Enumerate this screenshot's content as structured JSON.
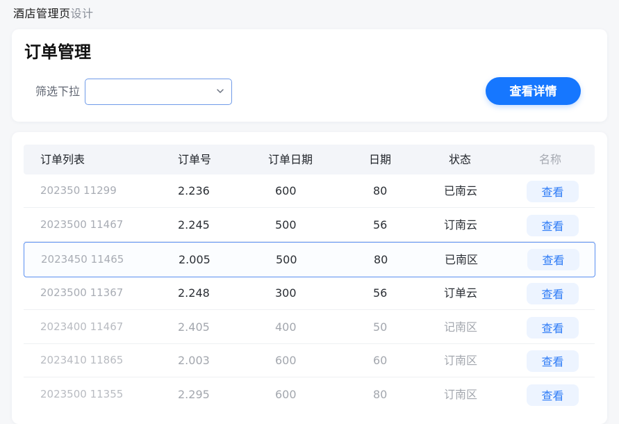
{
  "app_title": {
    "main": "酒店管理页",
    "sub": "设计"
  },
  "filter_section": {
    "title": "订单管理",
    "filter_label": "筛选下拉",
    "select_value": "",
    "detail_button_label": "查看详情",
    "icons": {
      "select_arrow": "chevron-down-icon"
    }
  },
  "table": {
    "headers": [
      "订单列表",
      "订单号",
      "订单日期",
      "日期",
      "状态",
      "名称"
    ],
    "rows": [
      {
        "order": "202350 11299",
        "number": "2.236",
        "date": "600",
        "day": "80",
        "status": "已南云",
        "action": "查看"
      },
      {
        "order": "2023500 11467",
        "number": "2.245",
        "date": "500",
        "day": "56",
        "status": "订南云",
        "action": "查看"
      },
      {
        "order": "2023450 11465",
        "number": "2.005",
        "date": "500",
        "day": "80",
        "status": "已南区",
        "action": "查看"
      },
      {
        "order": "2023500 11367",
        "number": "2.248",
        "date": "300",
        "day": "56",
        "status": "订单云",
        "action": "查看"
      },
      {
        "order": "2023400 11467",
        "number": "2.405",
        "date": "400",
        "day": "50",
        "status": "记南区",
        "action": "查看"
      },
      {
        "order": "2023410 11865",
        "number": "2.003",
        "date": "600",
        "day": "60",
        "status": "订南区",
        "action": "查看"
      },
      {
        "order": "2023500 11355",
        "number": "2.295",
        "date": "600",
        "day": "80",
        "status": "订南区",
        "action": "查看"
      }
    ],
    "selected_row": 2
  },
  "colors": {
    "accent": "#1677ff",
    "selection_border": "#5a8ff0",
    "button_bg": "#edf4ff"
  }
}
